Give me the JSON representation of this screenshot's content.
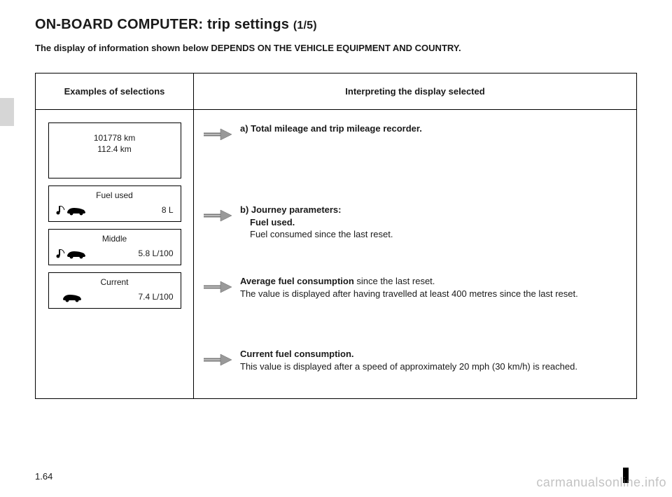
{
  "title_main": "ON-BOARD COMPUTER: trip settings ",
  "title_sub": "(1/5)",
  "note": "The display of information shown below DEPENDS ON THE VEHICLE EQUIPMENT AND COUNTRY.",
  "table": {
    "header_left": "Examples of selections",
    "header_right": "Interpreting the display selected"
  },
  "displays": {
    "d1_line1": "101778 km",
    "d1_line2": "112.4 km",
    "d2_header": "Fuel used",
    "d2_value": "8 L",
    "d3_header": "Middle",
    "d3_value": "5.8 L/100",
    "d4_header": "Current",
    "d4_value": "7.4 L/100"
  },
  "entries": {
    "a_label": "a) Total mileage and trip mileage recorder.",
    "b_label": "b) Journey parameters:",
    "b_sub_bold": "Fuel used.",
    "b_sub_text": "Fuel consumed since the last reset.",
    "c_bold": "Average fuel consumption",
    "c_rest": " since the last reset.",
    "c_line2": "The value is displayed after having travelled at least 400 metres since the last reset.",
    "d_bold": "Current fuel consumption.",
    "d_text": "This value is displayed after a speed of approximately 20 mph (30 km/h) is reached."
  },
  "page_number": "1.64",
  "watermark": "carmanualsonline.info"
}
